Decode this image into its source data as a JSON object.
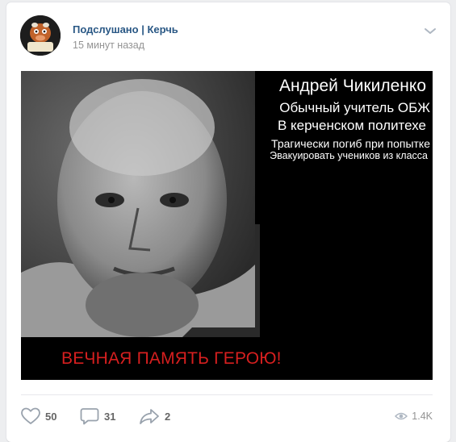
{
  "post": {
    "author": "Подслушано | Керчь",
    "time": "15 минут назад",
    "avatar_text": "Подслушано Керчь"
  },
  "image": {
    "lines": [
      "Андрей Чикиленко",
      "Обычный учитель ОБЖ",
      "В керченском политехе",
      "Трагически погиб при попытке",
      "Эвакуировать учеников из класса"
    ],
    "caption": "ВЕЧНАЯ ПАМЯТЬ ГЕРОЮ!"
  },
  "actions": {
    "likes": "50",
    "comments": "31",
    "shares": "2",
    "views": "1.4K"
  },
  "icons": {
    "more": "chevron-down-icon",
    "like": "heart-icon",
    "comment": "comment-icon",
    "share": "share-icon",
    "views": "eye-icon"
  },
  "colors": {
    "link": "#2a5885",
    "muted": "#939393",
    "caption_red": "#d61f1f"
  }
}
